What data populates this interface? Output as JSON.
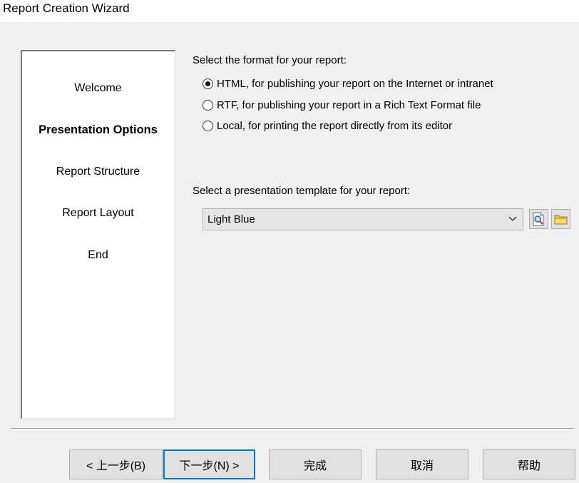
{
  "window": {
    "title": "Report Creation Wizard"
  },
  "steps": [
    {
      "label": "Welcome",
      "active": false
    },
    {
      "label": "Presentation Options",
      "active": true
    },
    {
      "label": "Report Structure",
      "active": false
    },
    {
      "label": "Report Layout",
      "active": false
    },
    {
      "label": "End",
      "active": false
    }
  ],
  "format": {
    "label": "Select the format for your report:",
    "options": [
      {
        "label": "HTML, for publishing your report on the Internet or intranet",
        "selected": true
      },
      {
        "label": "RTF, for publishing your report in a Rich Text Format file",
        "selected": false
      },
      {
        "label": "Local, for printing the report directly from its editor",
        "selected": false
      }
    ]
  },
  "template": {
    "label": "Select a presentation template for your report:",
    "selected": "Light Blue",
    "icons": [
      "preview-icon",
      "folder-icon"
    ]
  },
  "buttons": {
    "back": "< 上一步(B)",
    "next": "下一步(N) >",
    "finish": "完成",
    "cancel": "取消",
    "help": "帮助"
  },
  "colors": {
    "accent": "#0078d7",
    "background": "#f0f0f0"
  }
}
